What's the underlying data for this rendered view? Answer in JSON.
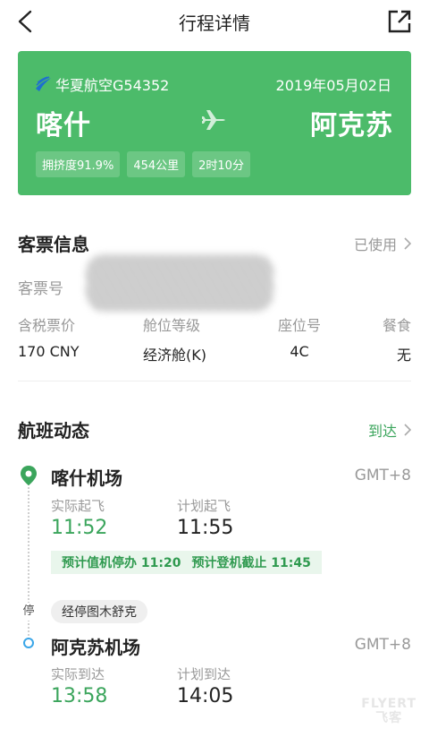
{
  "header": {
    "title": "行程详情"
  },
  "flight_card": {
    "airline": "华夏航空G54352",
    "date": "2019年05月02日",
    "from_city": "喀什",
    "to_city": "阿克苏",
    "chips": [
      "拥挤度91.9%",
      "454公里",
      "2时10分"
    ],
    "bg_color": "#4cbb6a"
  },
  "ticket": {
    "section_title": "客票信息",
    "status": "已使用",
    "ticket_no_label": "客票号",
    "fields": [
      {
        "label": "含税票价",
        "value": "170 CNY"
      },
      {
        "label": "舱位等级",
        "value": "经济舱(K)"
      },
      {
        "label": "座位号",
        "value": "4C"
      },
      {
        "label": "餐食",
        "value": "无"
      }
    ]
  },
  "flight_status": {
    "section_title": "航班动态",
    "status": "到达",
    "departure": {
      "airport": "喀什机场",
      "tz": "GMT+8",
      "actual_label": "实际起飞",
      "actual_time": "11:52",
      "planned_label": "计划起飞",
      "planned_time": "11:55"
    },
    "notice": [
      "预计值机停办 11:20",
      "预计登机截止 11:45"
    ],
    "stop": {
      "badge": "停",
      "text": "经停图木舒克"
    },
    "arrival": {
      "airport": "阿克苏机场",
      "tz": "GMT+8",
      "actual_label": "实际到达",
      "actual_time": "13:58",
      "planned_label": "计划到达",
      "planned_time": "14:05"
    }
  },
  "watermark": {
    "line1": "FLYERT",
    "line2": "飞客"
  },
  "colors": {
    "accent_green": "#3ba55c",
    "card_green": "#4cbb6a",
    "arrival_blue": "#3aa6e8"
  }
}
